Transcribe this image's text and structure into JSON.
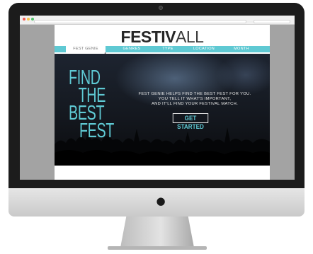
{
  "device": {
    "logo_glyph": ""
  },
  "browser": {
    "nav_arrows": "‹ ›"
  },
  "site": {
    "logo_part1": "FESTIV",
    "logo_part2": "ALL",
    "nav": [
      {
        "label": "FEST GENIE",
        "active": true
      },
      {
        "label": "GENRES",
        "active": false
      },
      {
        "label": "TYPE",
        "active": false
      },
      {
        "label": "LOCATION",
        "active": false
      },
      {
        "label": "MONTH",
        "active": false
      }
    ],
    "hero": {
      "headline": [
        "FIND",
        "THE",
        "BEST",
        "FEST"
      ],
      "tagline": [
        "FEST GENIE HELPS FIND THE BEST FEST FOR YOU.",
        "YOU TELL IT WHAT'S IMPORTANT,",
        "AND IT'LL FIND YOUR FESTIVAL MATCH."
      ],
      "cta_label": "GET STARTED"
    }
  },
  "colors": {
    "accent": "#5fc9d3",
    "bezel": "#1c1c1c",
    "hero_bg": "#14181f"
  }
}
